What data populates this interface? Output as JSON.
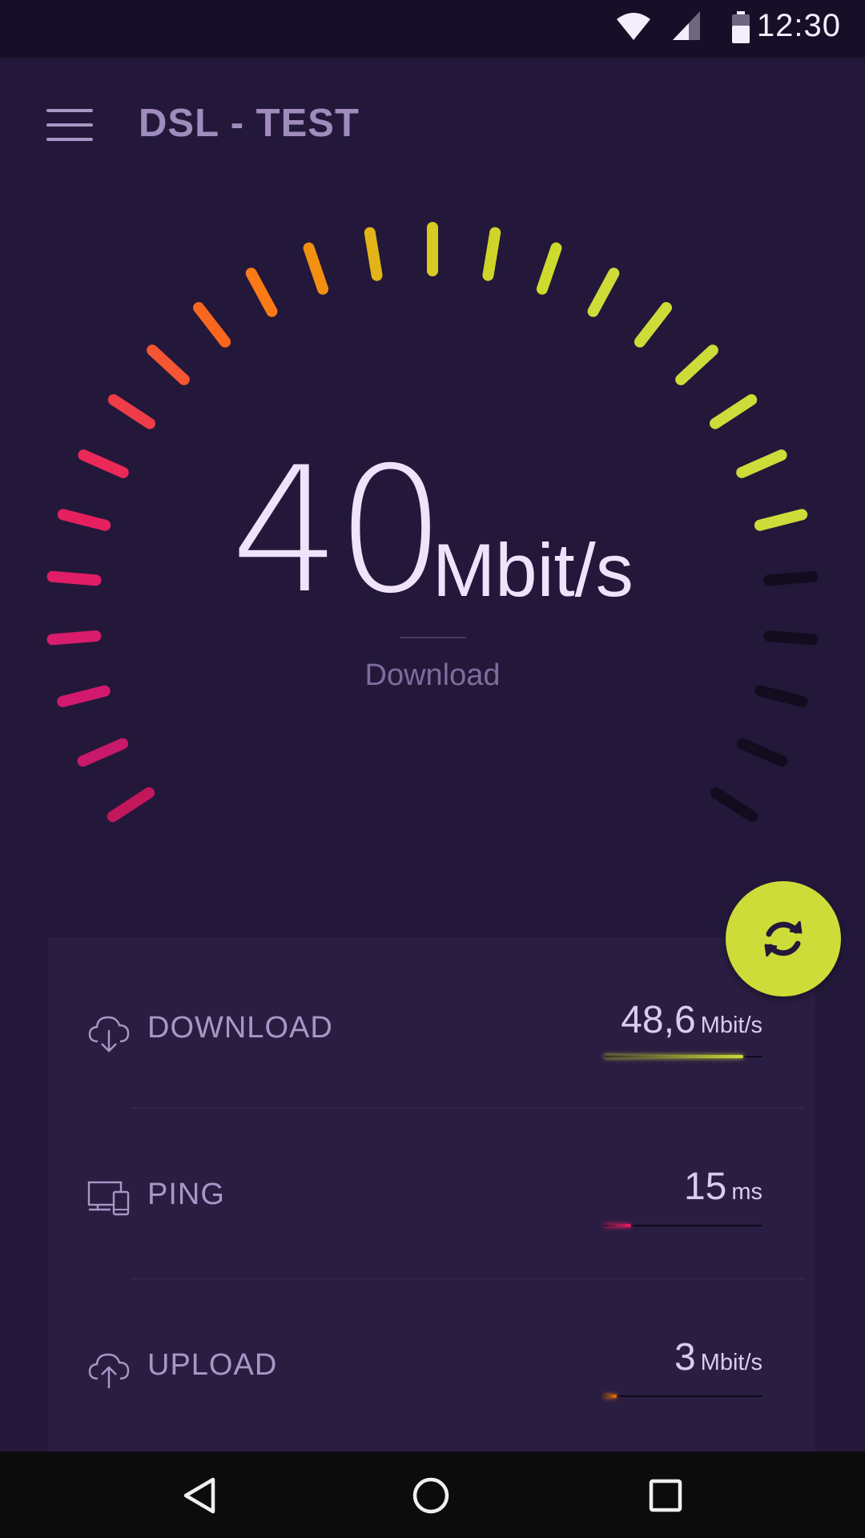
{
  "status_bar": {
    "time": "12:30",
    "icons": [
      "wifi-icon",
      "cellular-signal-icon",
      "battery-icon"
    ]
  },
  "app_bar": {
    "title": "DSL - TEST",
    "menu_icon": "hamburger-menu-icon"
  },
  "gauge": {
    "value": "40",
    "unit": "Mbit/s",
    "label": "Download",
    "total_ticks": 27,
    "active_ticks": 22,
    "tick_colors": [
      "#c2185b",
      "#c8196a",
      "#d11a6e",
      "#d91c6c",
      "#e11d67",
      "#e6205f",
      "#ea2958",
      "#ee3c48",
      "#f45533",
      "#f8671f",
      "#f97a17",
      "#f29011",
      "#e2b417",
      "#d7ca22",
      "#cfd528",
      "#cddb2c",
      "#cddc39",
      "#cddc39",
      "#cddc39",
      "#cddc39",
      "#cddc39",
      "#cddc39",
      "#120c1e",
      "#120c1e",
      "#120c1e",
      "#120c1e",
      "#120c1e"
    ]
  },
  "refresh_button": {
    "icon": "refresh-icon"
  },
  "results": [
    {
      "id": "download",
      "icon": "cloud-download-icon",
      "label": "DOWNLOAD",
      "value": "48,6",
      "unit": "Mbit/s",
      "bar_fraction": 0.88,
      "bar_color": "#cddc39"
    },
    {
      "id": "ping",
      "icon": "devices-icon",
      "label": "PING",
      "value": "15",
      "unit": "ms",
      "bar_fraction": 0.17,
      "bar_color": "#e91e63"
    },
    {
      "id": "upload",
      "icon": "cloud-upload-icon",
      "label": "UPLOAD",
      "value": "3",
      "unit": "Mbit/s",
      "bar_fraction": 0.08,
      "bar_color": "#f57c00"
    }
  ],
  "nav_bar": {
    "buttons": [
      "back-icon",
      "home-icon",
      "recents-icon"
    ]
  }
}
